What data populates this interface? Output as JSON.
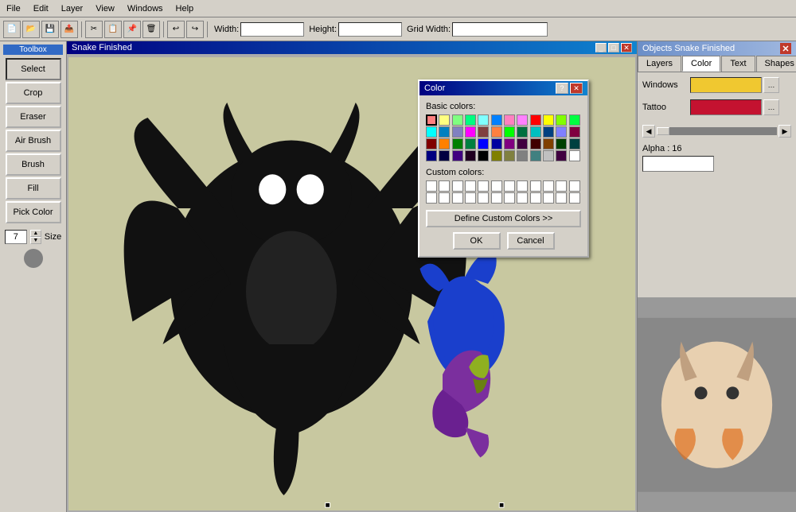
{
  "menubar": {
    "items": [
      "File",
      "Edit",
      "Layer",
      "View",
      "Windows",
      "Help"
    ]
  },
  "toolbar": {
    "width_label": "Width:",
    "height_label": "Height:",
    "gridwidth_label": "Grid Width:"
  },
  "toolbox": {
    "title": "Toolbox",
    "tools": [
      "Select",
      "Crop",
      "Eraser",
      "Air Brush",
      "Brush",
      "Fill",
      "Pick Color"
    ],
    "size_label": "Size",
    "size_value": "7"
  },
  "window_title": "Snake Finished",
  "right_panel": {
    "title": "Objects Snake Finished",
    "tabs": [
      "Layers",
      "Color",
      "Text",
      "Shapes"
    ],
    "active_tab": "Color",
    "windows_label": "Windows",
    "windows_color": "#f0c830",
    "tattoo_label": "Tattoo",
    "tattoo_color": "#c41230",
    "alpha_label": "Alpha : 16"
  },
  "color_dialog": {
    "title": "Color",
    "basic_colors_label": "Basic colors:",
    "custom_colors_label": "Custom colors:",
    "define_btn_label": "Define Custom Colors >>",
    "ok_label": "OK",
    "cancel_label": "Cancel",
    "basic_colors": [
      "#ff8080",
      "#ffff80",
      "#80ff80",
      "#00ff80",
      "#80ffff",
      "#0080ff",
      "#ff80c0",
      "#ff80ff",
      "#ff0000",
      "#ffff00",
      "#80ff00",
      "#00ff40",
      "#00ffff",
      "#0080c0",
      "#8080c0",
      "#ff00ff",
      "#804040",
      "#ff8040",
      "#00ff00",
      "#007040",
      "#00c0c0",
      "#004080",
      "#8080ff",
      "#800040",
      "#800000",
      "#ff8000",
      "#008000",
      "#008040",
      "#0000ff",
      "#0000a0",
      "#800080",
      "#400040",
      "#400000",
      "#804000",
      "#004000",
      "#004040",
      "#000080",
      "#000040",
      "#400080",
      "#200020",
      "#000000",
      "#808000",
      "#808040",
      "#808080",
      "#408080",
      "#c0c0c0",
      "#400040",
      "#ffffff"
    ],
    "custom_colors": [
      "",
      "",
      "",
      "",
      "",
      "",
      "",
      "",
      "",
      "",
      "",
      "",
      "",
      "",
      "",
      "",
      "",
      "",
      "",
      "",
      "",
      "",
      "",
      ""
    ]
  }
}
